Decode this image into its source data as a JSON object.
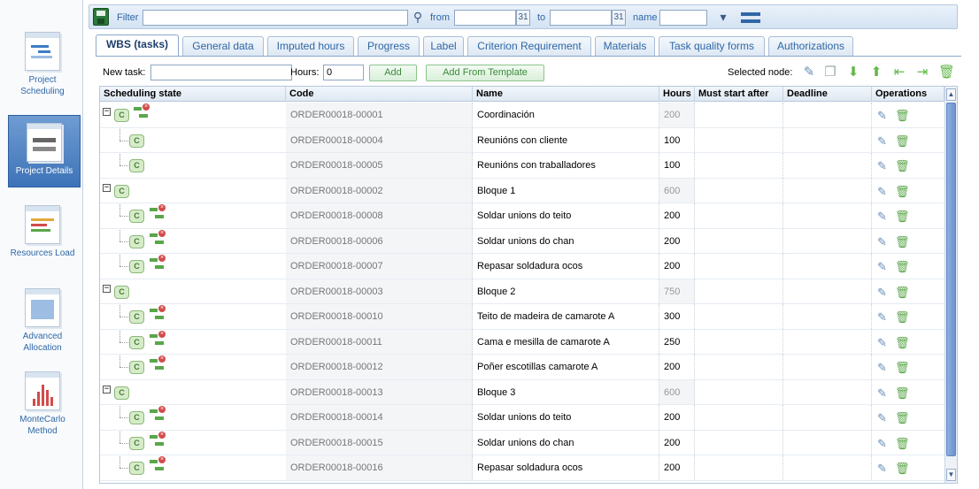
{
  "nav": {
    "items": [
      {
        "label": "Project Scheduling",
        "active": false
      },
      {
        "label": "Project Details",
        "active": true
      },
      {
        "label": "Resources Load",
        "active": false
      },
      {
        "label": "Advanced Allocation",
        "active": false
      },
      {
        "label": "MonteCarlo Method",
        "active": false
      }
    ]
  },
  "toolbar": {
    "filter_label": "Filter",
    "filter_value": "",
    "from_label": "from",
    "from_value": "",
    "to_label": "to",
    "to_value": "",
    "name_label": "name",
    "name_value": "",
    "calendar_glyph": "31"
  },
  "tabs": [
    {
      "label": "WBS (tasks)",
      "active": true
    },
    {
      "label": "General data"
    },
    {
      "label": "Imputed hours"
    },
    {
      "label": "Progress"
    },
    {
      "label": "Label"
    },
    {
      "label": "Criterion Requirement"
    },
    {
      "label": "Materials"
    },
    {
      "label": "Task quality forms"
    },
    {
      "label": "Authorizations"
    }
  ],
  "new_task": {
    "label": "New task:",
    "value": "",
    "hours_label": "Hours:",
    "hours_value": "0",
    "add_label": "Add",
    "add_template_label": "Add From Template",
    "selected_node_label": "Selected node:"
  },
  "grid": {
    "columns": [
      "Scheduling state",
      "Code",
      "Name",
      "Hours",
      "Must start after",
      "Deadline",
      "Operations"
    ],
    "rows": [
      {
        "level": 0,
        "toggle": "−",
        "badge": "C",
        "dep": true,
        "code": "ORDER00018-00001",
        "name": "Coordinación",
        "hours": "200",
        "hours_readonly": true
      },
      {
        "level": 1,
        "badge": "C",
        "dep": false,
        "code": "ORDER00018-00004",
        "name": "Reunións con cliente",
        "hours": "100",
        "hours_readonly": false
      },
      {
        "level": 1,
        "badge": "C",
        "dep": false,
        "code": "ORDER00018-00005",
        "name": "Reunións con traballadores",
        "hours": "100",
        "hours_readonly": false
      },
      {
        "level": 0,
        "toggle": "−",
        "badge": "C",
        "dep": false,
        "code": "ORDER00018-00002",
        "name": "Bloque 1",
        "hours": "600",
        "hours_readonly": true
      },
      {
        "level": 1,
        "badge": "C",
        "dep": true,
        "code": "ORDER00018-00008",
        "name": "Soldar unions do teito",
        "hours": "200",
        "hours_readonly": false
      },
      {
        "level": 1,
        "badge": "C",
        "dep": true,
        "code": "ORDER00018-00006",
        "name": "Soldar unions do chan",
        "hours": "200",
        "hours_readonly": false
      },
      {
        "level": 1,
        "badge": "C",
        "dep": true,
        "code": "ORDER00018-00007",
        "name": "Repasar soldadura ocos",
        "hours": "200",
        "hours_readonly": false
      },
      {
        "level": 0,
        "toggle": "−",
        "badge": "C",
        "dep": false,
        "code": "ORDER00018-00003",
        "name": "Bloque 2",
        "hours": "750",
        "hours_readonly": true
      },
      {
        "level": 1,
        "badge": "C",
        "dep": true,
        "code": "ORDER00018-00010",
        "name": "Teito de madeira de camarote A",
        "hours": "300",
        "hours_readonly": false
      },
      {
        "level": 1,
        "badge": "C",
        "dep": true,
        "code": "ORDER00018-00011",
        "name": "Cama e mesilla de camarote A",
        "hours": "250",
        "hours_readonly": false
      },
      {
        "level": 1,
        "badge": "C",
        "dep": true,
        "code": "ORDER00018-00012",
        "name": "Poñer escotillas camarote A",
        "hours": "200",
        "hours_readonly": false
      },
      {
        "level": 0,
        "toggle": "−",
        "badge": "C",
        "dep": false,
        "code": "ORDER00018-00013",
        "name": "Bloque 3",
        "hours": "600",
        "hours_readonly": true
      },
      {
        "level": 1,
        "badge": "C",
        "dep": true,
        "code": "ORDER00018-00014",
        "name": "Soldar unions do teito",
        "hours": "200",
        "hours_readonly": false
      },
      {
        "level": 1,
        "badge": "C",
        "dep": true,
        "code": "ORDER00018-00015",
        "name": "Soldar unions do chan",
        "hours": "200",
        "hours_readonly": false
      },
      {
        "level": 1,
        "badge": "C",
        "dep": true,
        "code": "ORDER00018-00016",
        "name": "Repasar soldadura ocos",
        "hours": "200",
        "hours_readonly": false
      }
    ]
  },
  "colors": {
    "accent": "#2f67a6",
    "green": "#5aa64a",
    "badge_bg": "#d6ecc9"
  }
}
